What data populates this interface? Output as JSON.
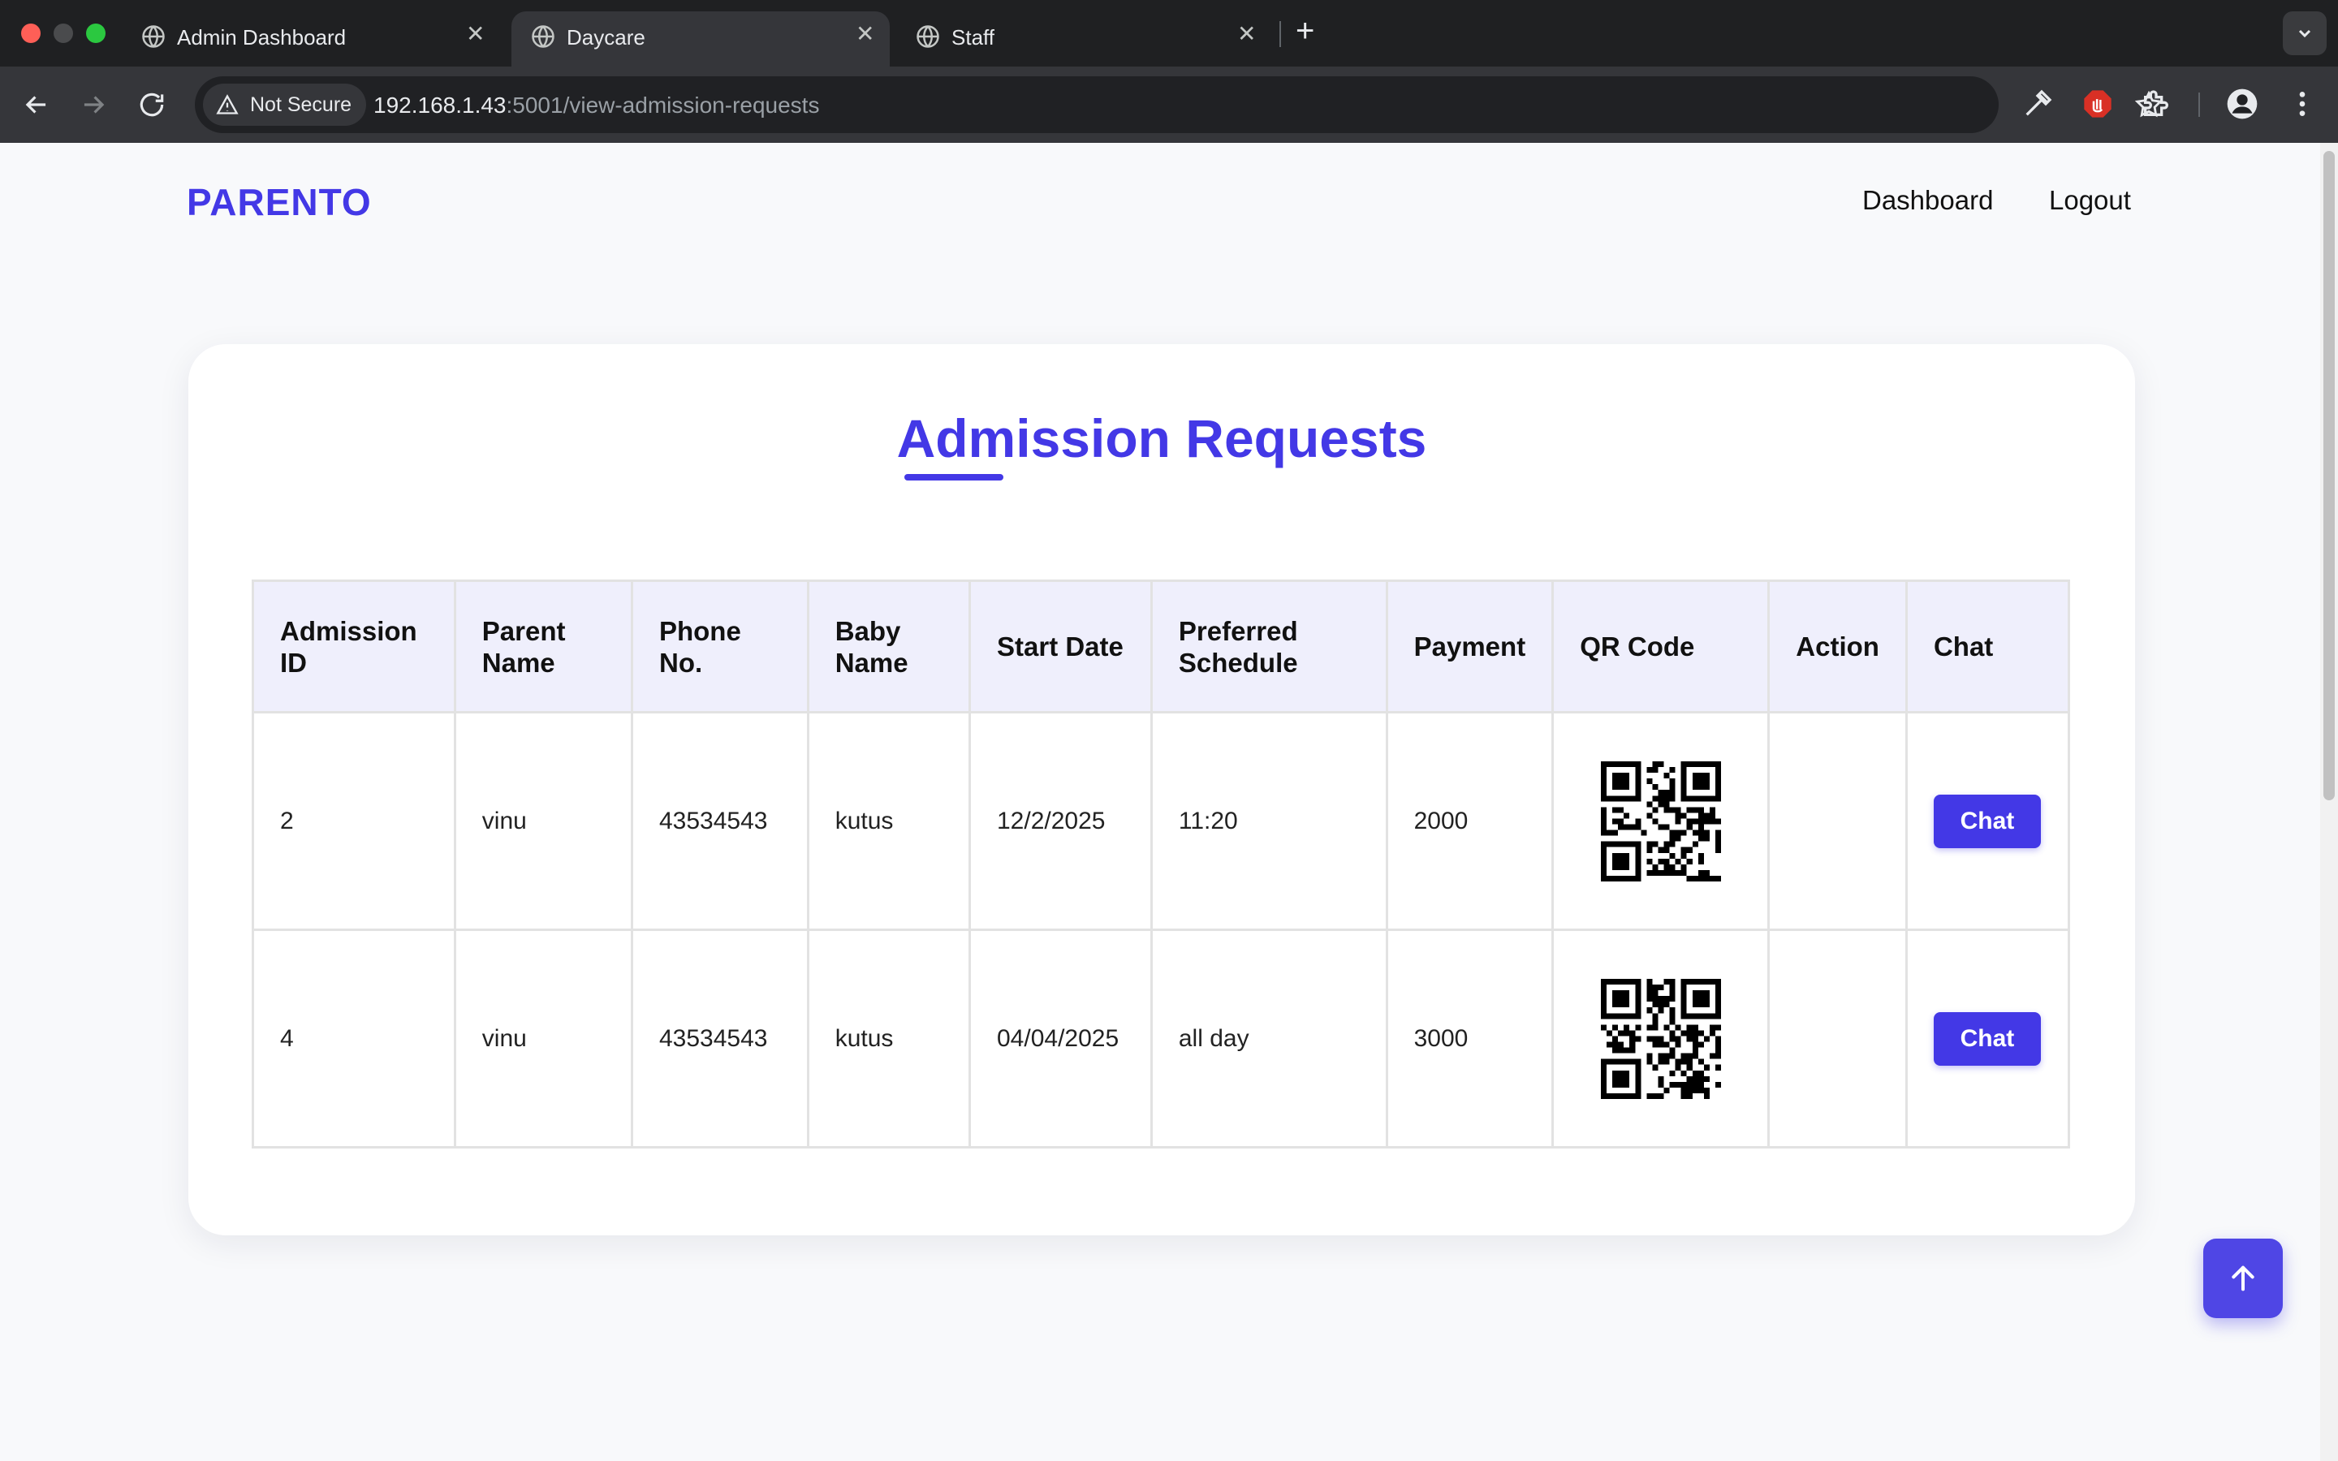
{
  "browser": {
    "tabs": [
      {
        "title": "Admin Dashboard",
        "active": false
      },
      {
        "title": "Daycare",
        "active": true
      },
      {
        "title": "Staff",
        "active": false
      }
    ],
    "security_label": "Not Secure",
    "url_host": "192.168.1.43",
    "url_path": ":5001/view-admission-requests"
  },
  "nav": {
    "brand": "PARENTO",
    "links": [
      "Dashboard",
      "Logout"
    ]
  },
  "main": {
    "title": "Admission Requests",
    "table": {
      "headers": [
        "Admission ID",
        "Parent Name",
        "Phone No.",
        "Baby Name",
        "Start Date",
        "Preferred Schedule",
        "Payment",
        "QR Code",
        "Action",
        "Chat"
      ],
      "rows": [
        {
          "admission_id": "2",
          "parent_name": "vinu",
          "phone": "43534543",
          "baby_name": "kutus",
          "start_date": "12/2/2025",
          "schedule": "11:20",
          "payment": "2000",
          "action": "",
          "chat_label": "Chat"
        },
        {
          "admission_id": "4",
          "parent_name": "vinu",
          "phone": "43534543",
          "baby_name": "kutus",
          "start_date": "04/04/2025",
          "schedule": "all day",
          "payment": "3000",
          "action": "",
          "chat_label": "Chat"
        }
      ]
    }
  },
  "colors": {
    "accent": "#4338e6",
    "header_bg": "#efeffc"
  }
}
